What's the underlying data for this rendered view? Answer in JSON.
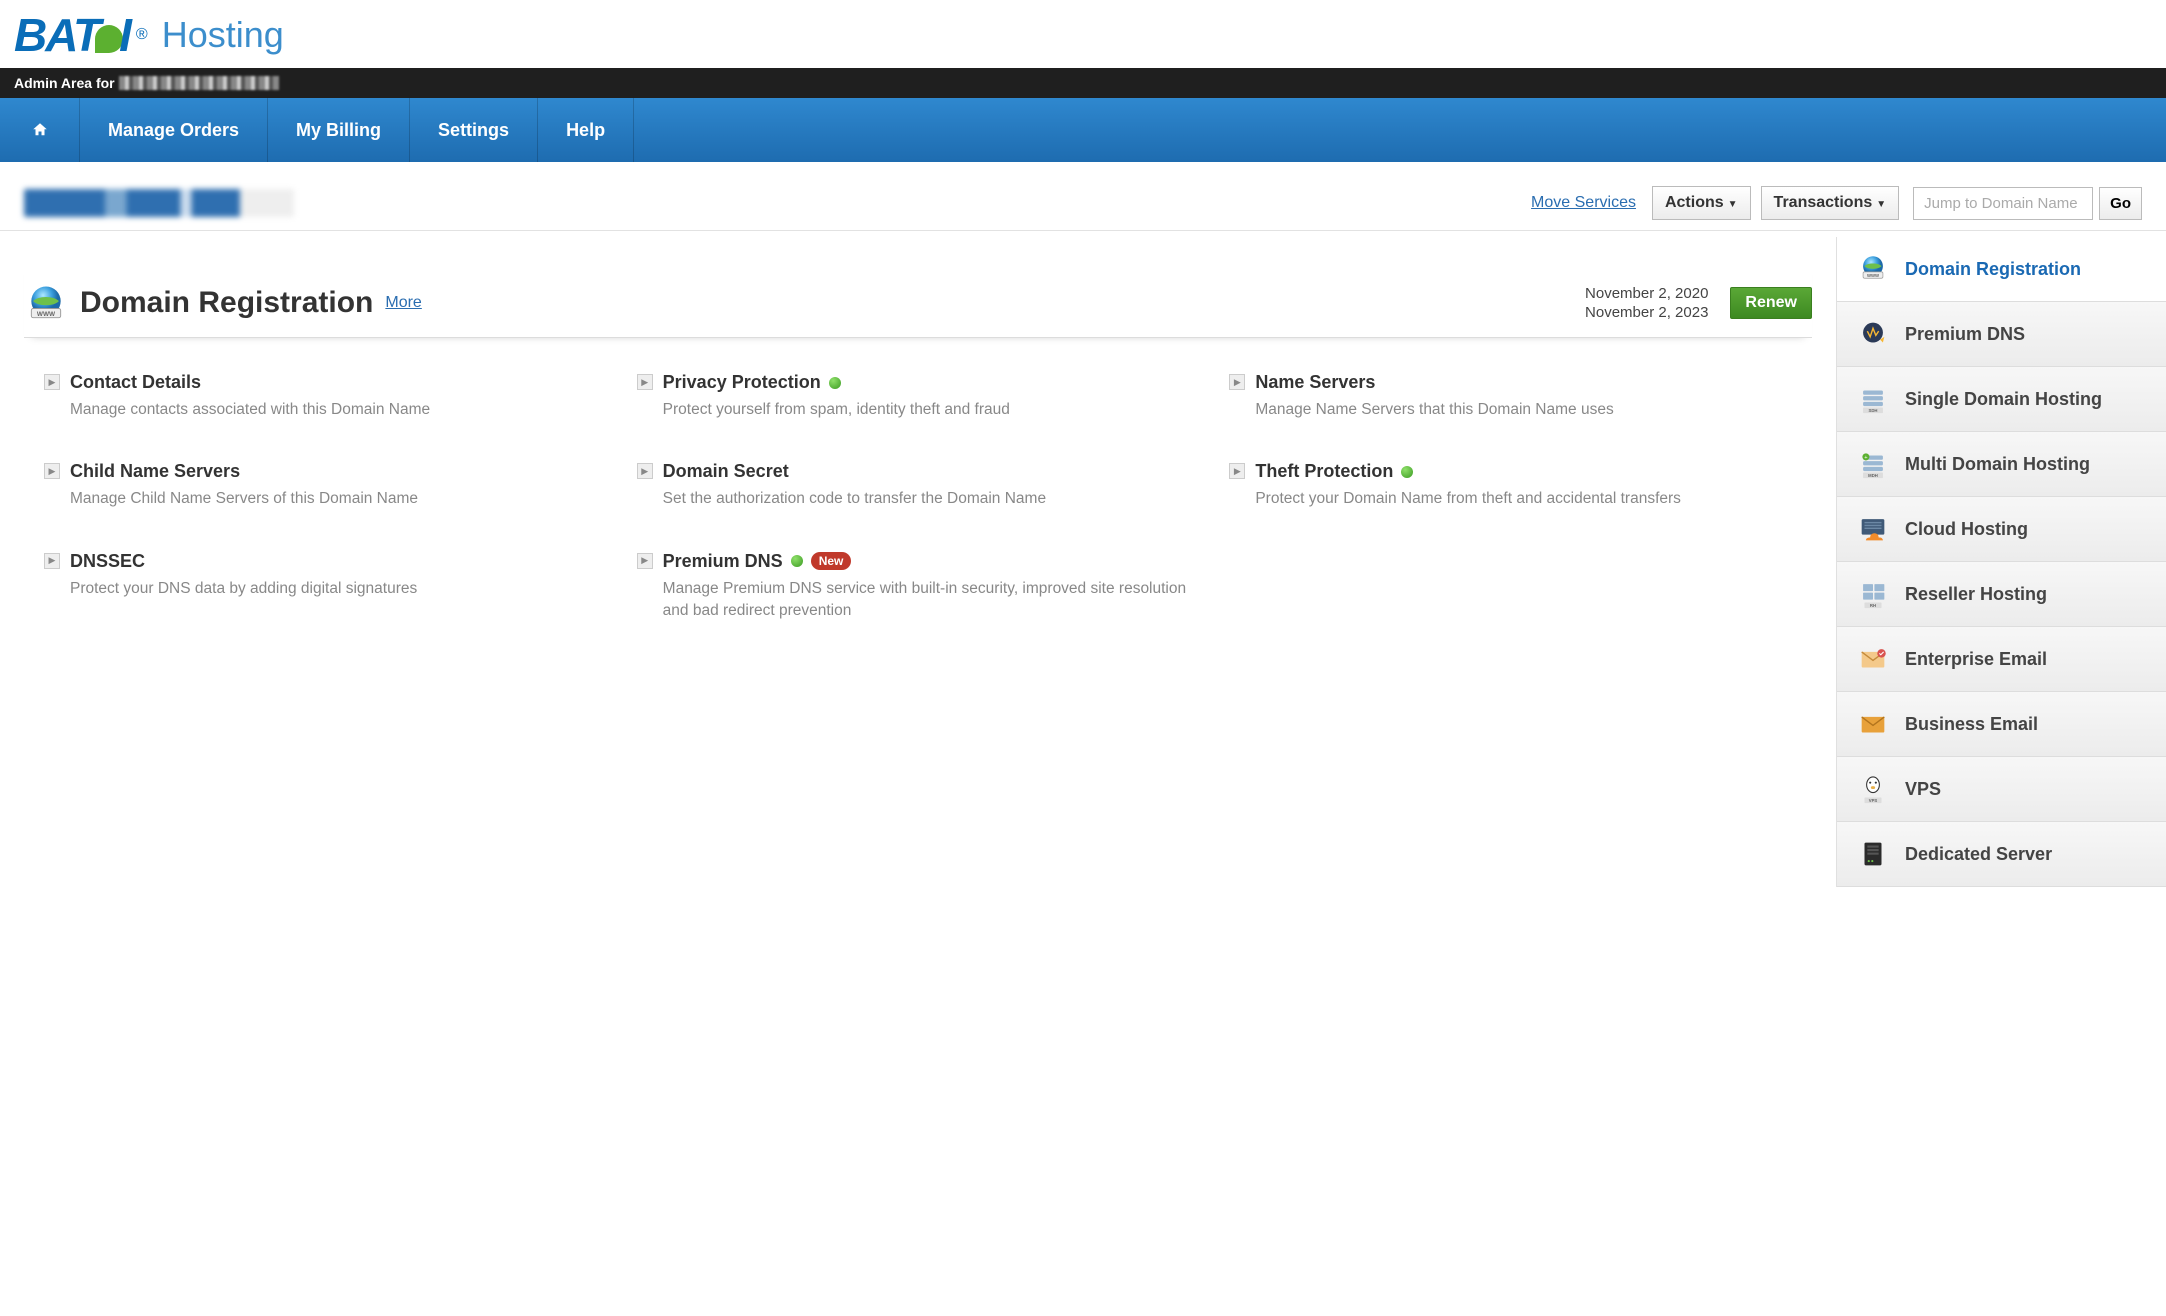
{
  "brand": {
    "word": "BAT I",
    "suffix": "Hosting",
    "reg": "®"
  },
  "black_bar": {
    "prefix": "Admin Area for"
  },
  "nav": {
    "items": [
      {
        "label": ""
      },
      {
        "label": "Manage Orders"
      },
      {
        "label": "My Billing"
      },
      {
        "label": "Settings"
      },
      {
        "label": "Help"
      }
    ]
  },
  "top": {
    "move_services": "Move Services",
    "actions": "Actions",
    "transactions": "Transactions",
    "search_placeholder": "Jump to Domain Name",
    "go": "Go"
  },
  "section": {
    "title": "Domain Registration",
    "more": "More",
    "date1": "November 2, 2020",
    "date2": "November 2, 2023",
    "renew": "Renew"
  },
  "cards": [
    {
      "title": "Contact Details",
      "desc": "Manage contacts associated with this Domain Name",
      "dot": false,
      "new": false
    },
    {
      "title": "Privacy Protection",
      "desc": "Protect yourself from spam, identity theft and fraud",
      "dot": true,
      "new": false
    },
    {
      "title": "Name Servers",
      "desc": "Manage Name Servers that this Domain Name uses",
      "dot": false,
      "new": false
    },
    {
      "title": "Child Name Servers",
      "desc": "Manage Child Name Servers of this Domain Name",
      "dot": false,
      "new": false
    },
    {
      "title": "Domain Secret",
      "desc": "Set the authorization code to transfer the Domain Name",
      "dot": false,
      "new": false
    },
    {
      "title": "Theft Protection",
      "desc": "Protect your Domain Name from theft and accidental transfers",
      "dot": true,
      "new": false
    },
    {
      "title": "DNSSEC",
      "desc": "Protect your DNS data by adding digital signatures",
      "dot": false,
      "new": false
    },
    {
      "title": "Premium DNS",
      "desc": "Manage Premium DNS service with built-in security, improved site resolution and bad redirect prevention",
      "dot": true,
      "new": true
    }
  ],
  "new_label": "New",
  "sidebar": [
    {
      "label": "Domain Registration",
      "icon": "globe",
      "active": true
    },
    {
      "label": "Premium DNS",
      "icon": "pdns",
      "active": false
    },
    {
      "label": "Single Domain Hosting",
      "icon": "sdh",
      "active": false
    },
    {
      "label": "Multi Domain Hosting",
      "icon": "mdh",
      "active": false
    },
    {
      "label": "Cloud Hosting",
      "icon": "cloud",
      "active": false
    },
    {
      "label": "Reseller Hosting",
      "icon": "reseller",
      "active": false
    },
    {
      "label": "Enterprise Email",
      "icon": "eemail",
      "active": false
    },
    {
      "label": "Business Email",
      "icon": "bemail",
      "active": false
    },
    {
      "label": "VPS",
      "icon": "vps",
      "active": false
    },
    {
      "label": "Dedicated Server",
      "icon": "server",
      "active": false
    }
  ]
}
